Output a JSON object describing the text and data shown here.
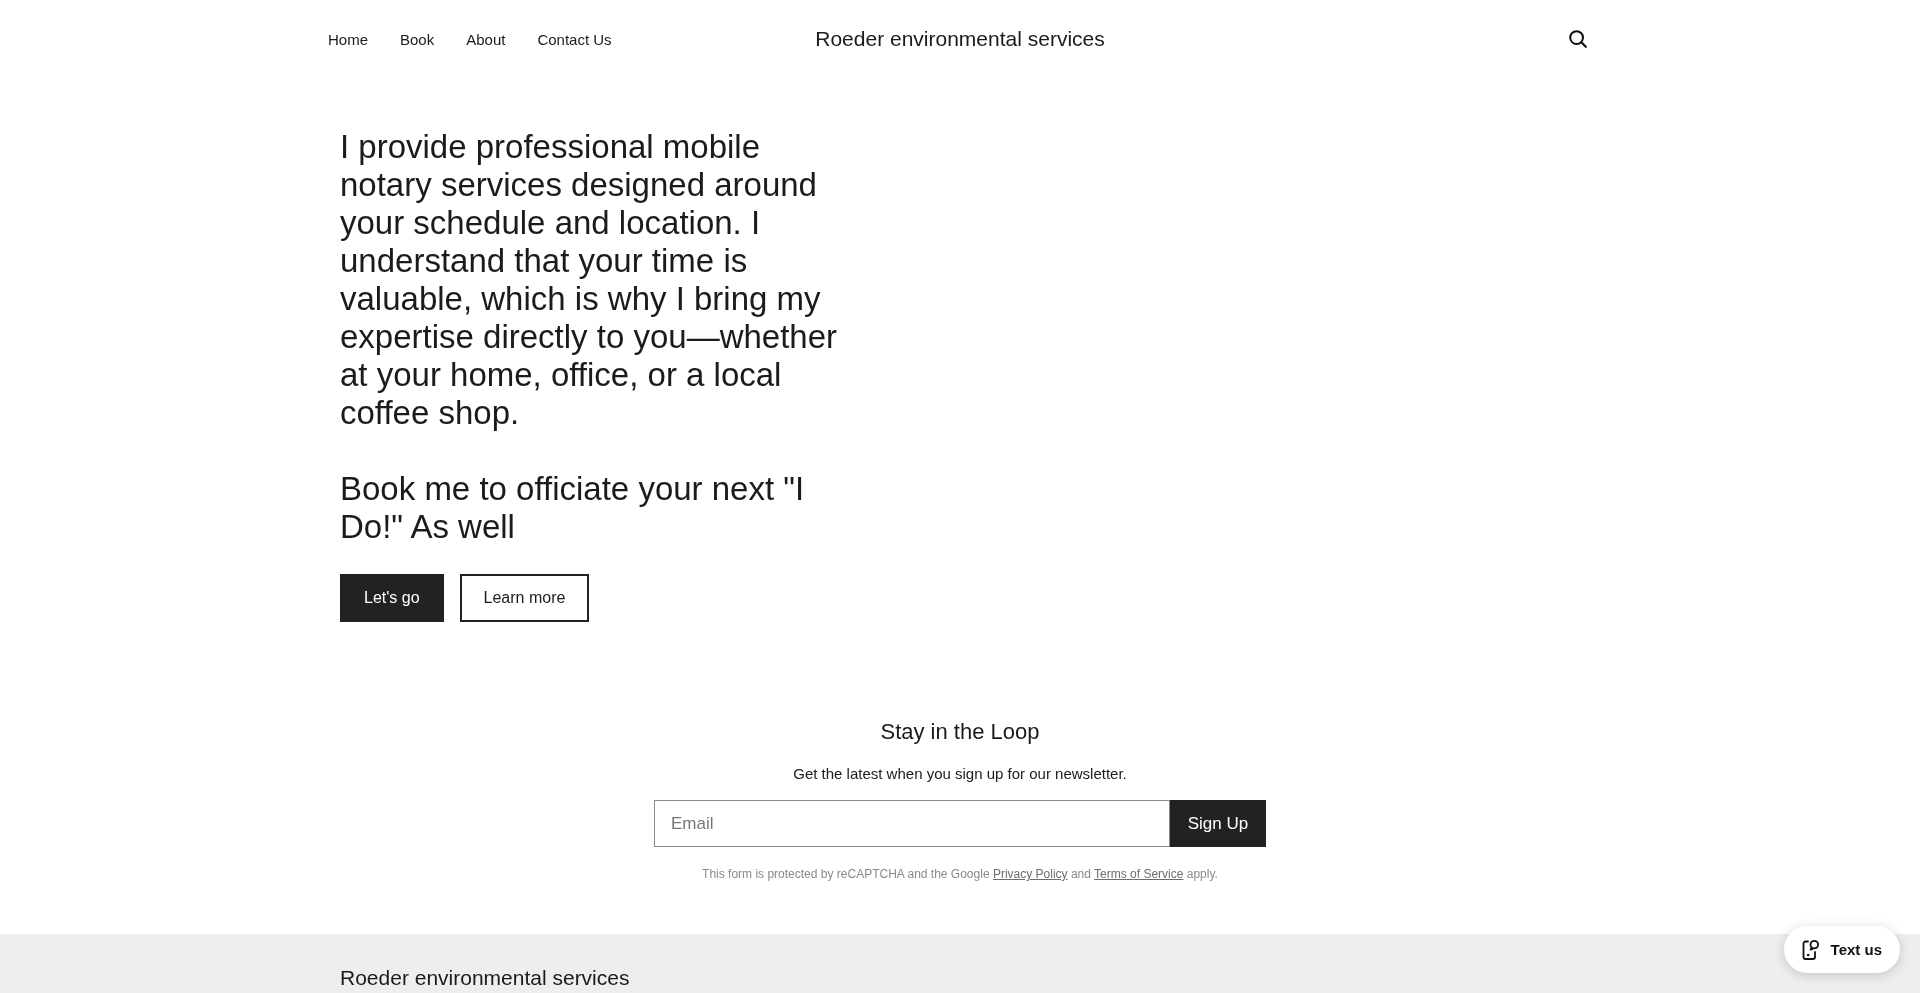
{
  "header": {
    "nav": [
      "Home",
      "Book",
      "About",
      "Contact Us"
    ],
    "site_title": "Roeder environmental services"
  },
  "hero": {
    "paragraphs": [
      "I provide professional mobile notary services designed around your schedule and location. I understand that your time is valuable, which is why I bring my expertise directly to you—whether at your home, office, or a local coffee shop.",
      "Book me to officiate your next \"I Do!\" As well"
    ],
    "buttons": [
      {
        "label": "Let's go",
        "kind": "primary"
      },
      {
        "label": "Learn more",
        "kind": "outline"
      }
    ]
  },
  "newsletter": {
    "title": "Stay in the Loop",
    "subtitle": "Get the latest when you sign up for our newsletter.",
    "email": {
      "placeholder": "Email"
    },
    "button": "Sign Up",
    "legal": [
      {
        "kind": "text",
        "text": "This form is protected by reCAPTCHA and the Google "
      },
      {
        "kind": "link",
        "text": "Privacy Policy"
      },
      {
        "kind": "text",
        "text": " and "
      },
      {
        "kind": "link",
        "text": "Terms of Service"
      },
      {
        "kind": "text",
        "text": " apply."
      }
    ]
  },
  "footer": {
    "site_title": "Roeder environmental services"
  },
  "chat_button": {
    "label": "Text us"
  }
}
